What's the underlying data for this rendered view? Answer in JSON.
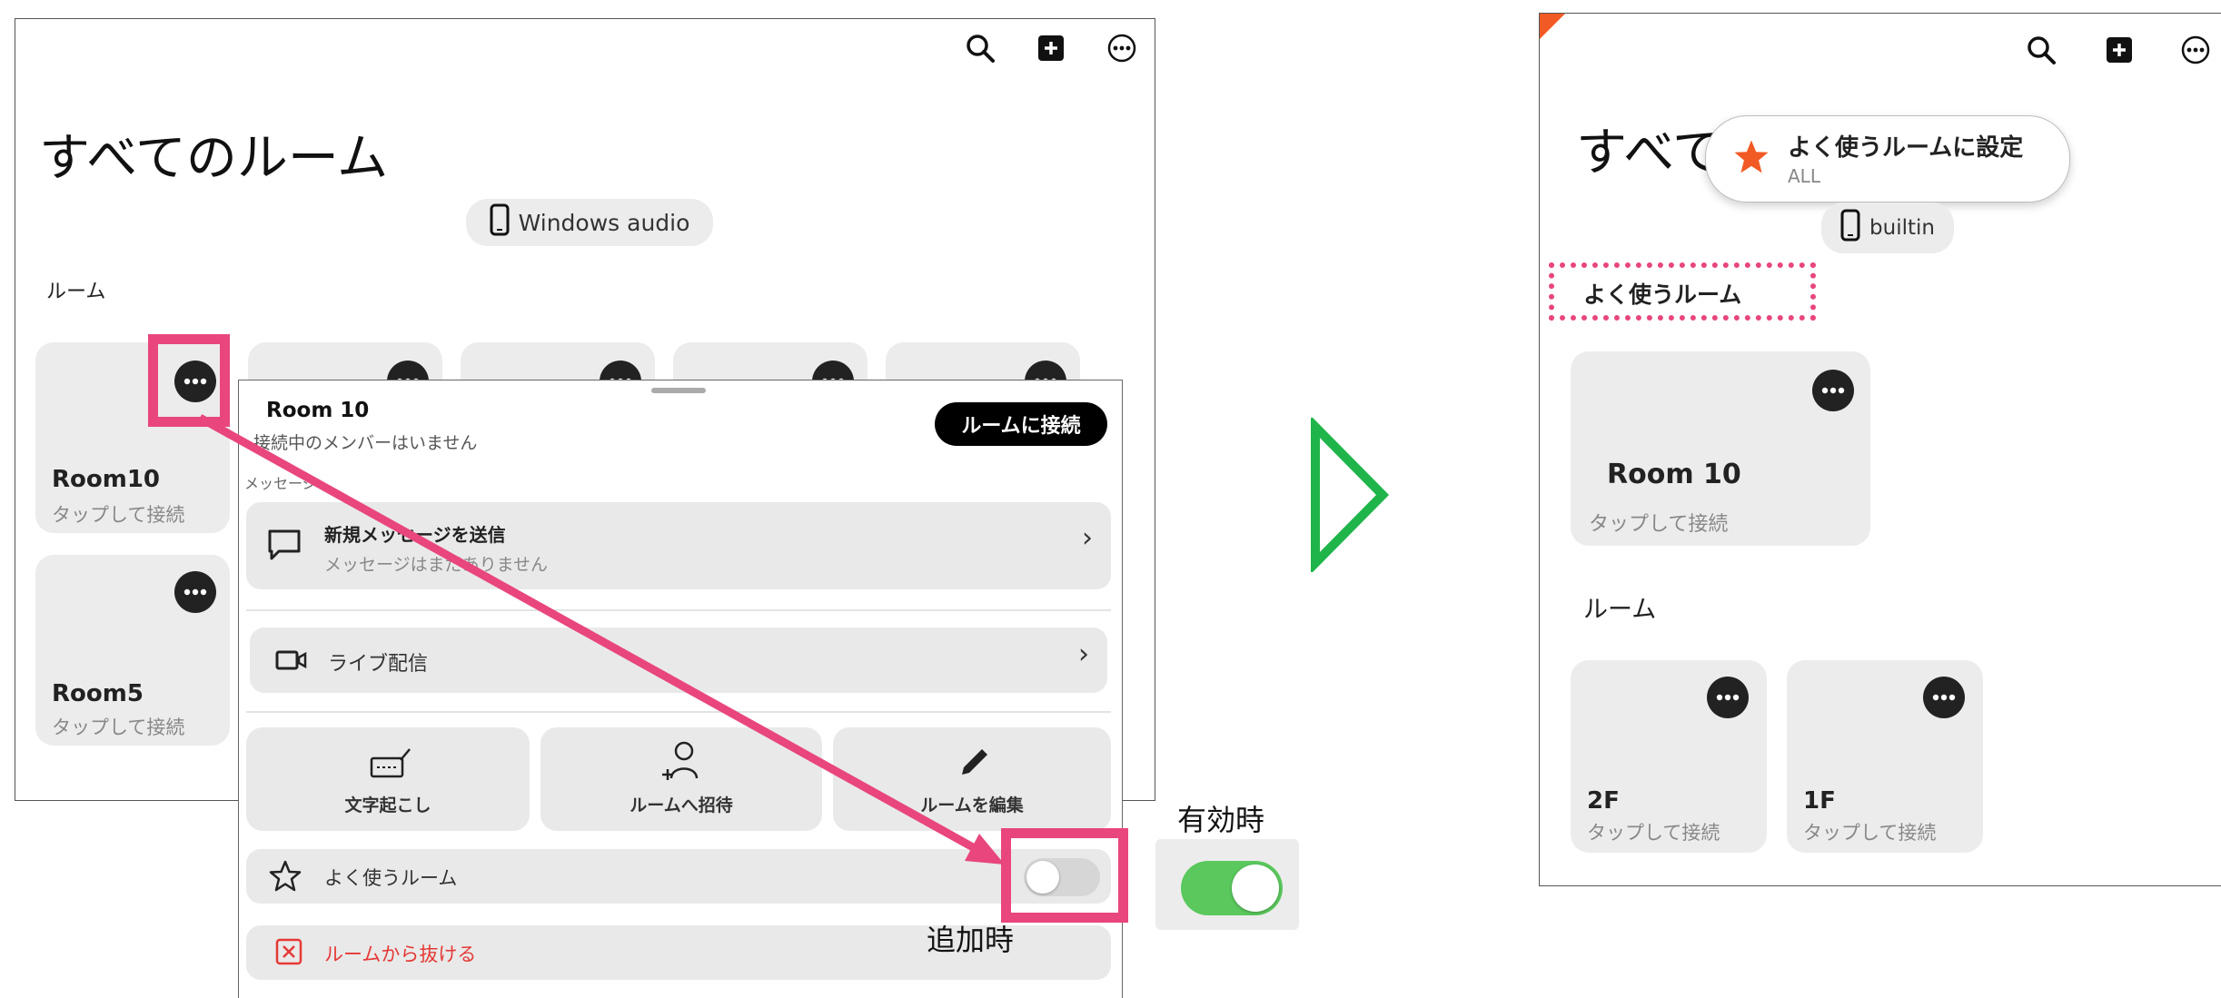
{
  "left": {
    "title": "すべてのルーム",
    "device_pill": "Windows audio",
    "section_label": "ルーム",
    "tiles": [
      {
        "name": "Room10",
        "sub": "タップして接続"
      },
      {
        "name": "Room5",
        "sub": "タップして接続"
      }
    ]
  },
  "sheet": {
    "room_name": "Room 10",
    "no_members": "接続中のメンバーはいません",
    "connect_button": "ルームに接続",
    "messages_label": "メッセージ",
    "new_message": "新規メッセージを送信",
    "no_messages": "メッセージはまだありません",
    "live": "ライブ配信",
    "actions": [
      "文字起こし",
      "ルームへ招待",
      "ルームを編集"
    ],
    "favorite": "よく使うルーム",
    "leave": "ルームから抜ける"
  },
  "annotations": {
    "enabled_label": "有効時",
    "added_label": "追加時"
  },
  "right": {
    "title_partial": "すべて",
    "toast_title": "よく使うルームに設定",
    "toast_sub": "ALL",
    "device_pill": "builtin",
    "favorites_label": "よく使うルーム",
    "favorite_tile": {
      "name": "Room 10",
      "sub": "タップして接続"
    },
    "section_label": "ルーム",
    "tiles": [
      {
        "name": "2F",
        "sub": "タップして接続"
      },
      {
        "name": "1F",
        "sub": "タップして接続"
      }
    ]
  },
  "colors": {
    "accent_pink": "#e8467c",
    "arrow_green": "#1fb54a",
    "toggle_green": "#5ac85d",
    "star_orange": "#f15a24",
    "leave_red": "#e53935"
  },
  "toggle_state": {
    "favorite_toggle_on": false,
    "enabled_example_on": true
  }
}
